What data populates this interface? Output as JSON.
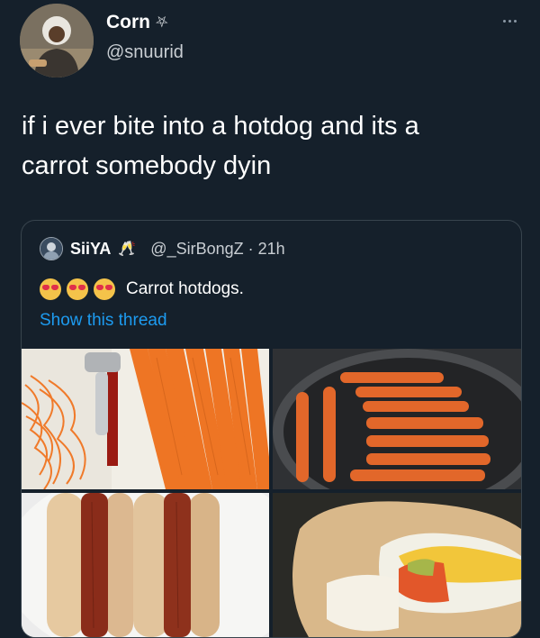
{
  "author": {
    "display_name": "Corn",
    "name_emoji": "⛧",
    "handle": "@snuurid"
  },
  "tweet": {
    "line1": "if i ever bite into a hotdog and its a",
    "line2": "carrot somebody dyin"
  },
  "quoted_tweet": {
    "display_name": "SiiYA",
    "name_emoji": "🥂",
    "handle_time": "@_SirBongZ · 21h",
    "emojis": [
      "heart-eyes",
      "heart-eyes",
      "heart-eyes"
    ],
    "text": "Carrot hotdogs.",
    "show_thread": "Show this thread"
  },
  "colors": {
    "background": "#15202b",
    "text": "#ffffff",
    "secondary": "#c9ced3",
    "link": "#1d9bf0",
    "border": "#38444d"
  },
  "icons": {
    "more": "more-icon",
    "avatar": "avatar",
    "quoted_avatar": "quoted-avatar"
  }
}
